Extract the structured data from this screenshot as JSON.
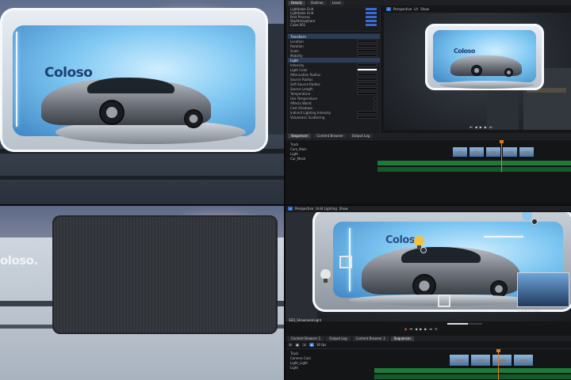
{
  "colors": {
    "accent_blue": "#2f6fd6",
    "timeline_green": "#1f7a3a",
    "playhead_orange": "#e07b1d",
    "editor_bg": "#151618"
  },
  "photo_top": {
    "brand_text": "Coloso"
  },
  "photo_bottom": {
    "brand_text": "oloso."
  },
  "editor_top": {
    "tabs": [
      "Details",
      "Outliner",
      "Level"
    ],
    "outliner_rows": [
      "Lightbake Grid",
      "Lightbake Grid",
      "Post Process",
      "SkyAtmosphere",
      "Cube.001"
    ],
    "detail_rows": [
      "Transform",
      "Location",
      "Rotation",
      "Scale",
      "Mobility",
      "Light",
      "Intensity",
      "Light Color",
      "Attenuation Radius",
      "Source Radius",
      "Soft Source Radius",
      "Source Length",
      "Temperature",
      "Use Temperature",
      "Affects World",
      "Cast Shadows",
      "Indirect Lighting Intensity",
      "Volumetric Scattering"
    ],
    "viewport_tabs": [
      "Perspective",
      "Lit",
      "Show"
    ],
    "timeline_tabs": [
      "Sequencer",
      "Content Browser",
      "Output Log"
    ],
    "tracks": [
      "Track",
      "Cam_Main",
      "Light",
      "Car_Mesh"
    ],
    "brand_text": "Coloso"
  },
  "editor_bottom": {
    "viewport_tabs": [
      "Perspective",
      "Unlit Lighting",
      "Show"
    ],
    "brand_text": "Coloso",
    "pip_label": "Camera Actor",
    "status_left": "SEQ_ShowroomLight",
    "timeline_tabs": [
      "Content Browser 1",
      "Output Log",
      "Content Browser 2",
      "Sequencer"
    ],
    "fps": "30 fps",
    "tracks": [
      "Track",
      "Camera Cuts",
      "Light_Light",
      "Light"
    ]
  }
}
